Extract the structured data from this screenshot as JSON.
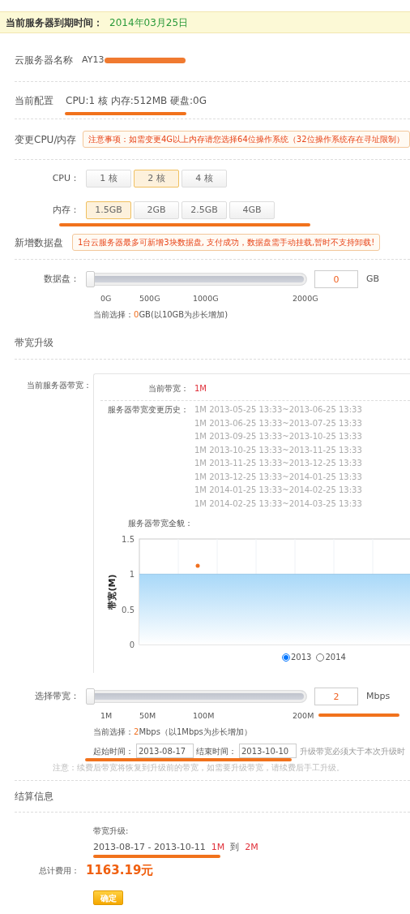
{
  "expiry": {
    "label": "当前服务器到期时间：",
    "value": "2014年03月25日"
  },
  "server_name": {
    "label": "云服务器名称",
    "value": "AY13"
  },
  "current_config": {
    "label": "当前配置",
    "value": "CPU:1 核 内存:512MB 硬盘:0G"
  },
  "change_cpu": {
    "label": "变更CPU/内存",
    "notice": "注意事项：如需变更4G以上内存请您选择64位操作系统（32位操作系统存在寻址限制）",
    "cpu": {
      "label": "CPU：",
      "options": [
        {
          "label": "1 核",
          "selected": false
        },
        {
          "label": "2 核",
          "selected": true
        },
        {
          "label": "4 核",
          "selected": false
        }
      ]
    },
    "memory": {
      "label": "内存：",
      "options": [
        {
          "label": "1.5GB",
          "selected": true
        },
        {
          "label": "2GB",
          "selected": false
        },
        {
          "label": "2.5GB",
          "selected": false
        },
        {
          "label": "4GB",
          "selected": false
        }
      ]
    }
  },
  "data_disk": {
    "label": "新增数据盘",
    "notice": "1台云服务器最多可新增3块数据盘, 支付成功，数据盘需手动挂载,暂时不支持卸载!",
    "slider": {
      "label": "数据盘：",
      "level": 0,
      "value": "0",
      "unit": "GB",
      "ticks": [
        "0G",
        "500G",
        "1000G",
        "2000G"
      ]
    },
    "selection": {
      "prefix": "当前选择：",
      "value": "0",
      "suffix": "GB(以10GB为步长增加)"
    }
  },
  "bandwidth": {
    "heading": "带宽升级",
    "panel_label": "当前服务器带宽：",
    "current": {
      "label": "当前带宽：",
      "value": "1M"
    },
    "history": {
      "label": "服务器带宽变更历史：",
      "entries": [
        "1M 2013-05-25 13:33~2013-06-25 13:33",
        "1M 2013-06-25 13:33~2013-07-25 13:33",
        "1M 2013-09-25 13:33~2013-10-25 13:33",
        "1M 2013-10-25 13:33~2013-11-25 13:33",
        "1M 2013-11-25 13:33~2013-12-25 13:33",
        "1M 2013-12-25 13:33~2014-01-25 13:33",
        "1M 2014-01-25 13:33~2014-02-25 13:33",
        "1M 2014-02-25 13:33~2014-03-25 13:33"
      ]
    },
    "overview": {
      "label": "服务器带宽全貌：",
      "chart_data": {
        "type": "area",
        "grid": true,
        "ylabel": "带宽(M)",
        "ylim": [
          0,
          1.5
        ],
        "yticks": [
          0,
          0.5,
          1,
          1.5
        ],
        "series": [
          {
            "color": "#a8d8f8",
            "values": [
              1,
              1,
              1,
              1,
              1,
              1,
              1,
              1,
              1
            ]
          }
        ]
      },
      "legend": [
        {
          "label": "2013",
          "selected": true
        },
        {
          "label": "2014",
          "selected": false
        }
      ]
    },
    "slider": {
      "label": "选择带宽：",
      "level": 0,
      "value": "2",
      "unit": "Mbps",
      "ticks": [
        "1M",
        "50M",
        "100M",
        "200M"
      ]
    },
    "selection": {
      "prefix": "当前选择：",
      "value": "2",
      "suffix": "Mbps（以1Mbps为步长增加）"
    },
    "start": {
      "label": "起始时间：",
      "value": "2013-08-17"
    },
    "end": {
      "label": "结束时间：",
      "value": "2013-10-10"
    },
    "hint": "升级带宽必须大于本次升级时",
    "note": "注意：续费后带宽将恢复到升级前的带宽，如需要升级带宽，请续费后手工升级。"
  },
  "settlement": {
    "heading": "结算信息",
    "detail_label": "带宽升级:",
    "period": "2013-08-17 - 2013-10-11",
    "from": "1M",
    "to_word": "到",
    "to": "2M",
    "total_label": "总计费用：",
    "total": "1163.19元",
    "confirm": "确定"
  }
}
